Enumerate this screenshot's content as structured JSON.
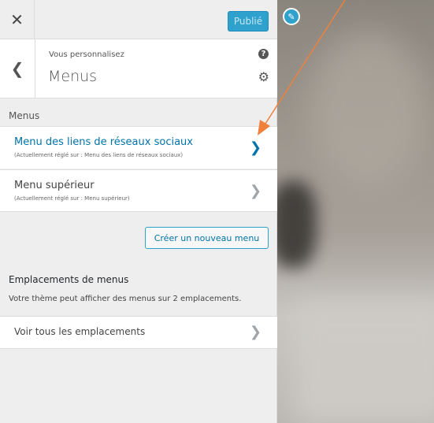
{
  "topbar": {
    "close_icon": "close-icon",
    "publish_label": "Publié"
  },
  "header": {
    "customizing_label": "Vous personnalisez",
    "title": "Menus",
    "help_icon": "help-icon",
    "gear_icon": "gear-icon"
  },
  "menus": {
    "heading": "Menus",
    "items": [
      {
        "name": "Menu des liens de réseaux sociaux",
        "sub": "(Actuellement réglé sur : Menu des liens de réseaux sociaux)"
      },
      {
        "name": "Menu supérieur",
        "sub": "(Actuellement réglé sur : Menu supérieur)"
      }
    ],
    "create_label": "Créer un nouveau menu"
  },
  "locations": {
    "heading": "Emplacements de menus",
    "description": "Votre thème peut afficher des menus sur 2 emplacements.",
    "view_all_label": "Voir tous les emplacements"
  },
  "colors": {
    "accent": "#0073aa",
    "publish_bg": "#2ea2cc",
    "annotation_arrow": "#f0803c"
  }
}
